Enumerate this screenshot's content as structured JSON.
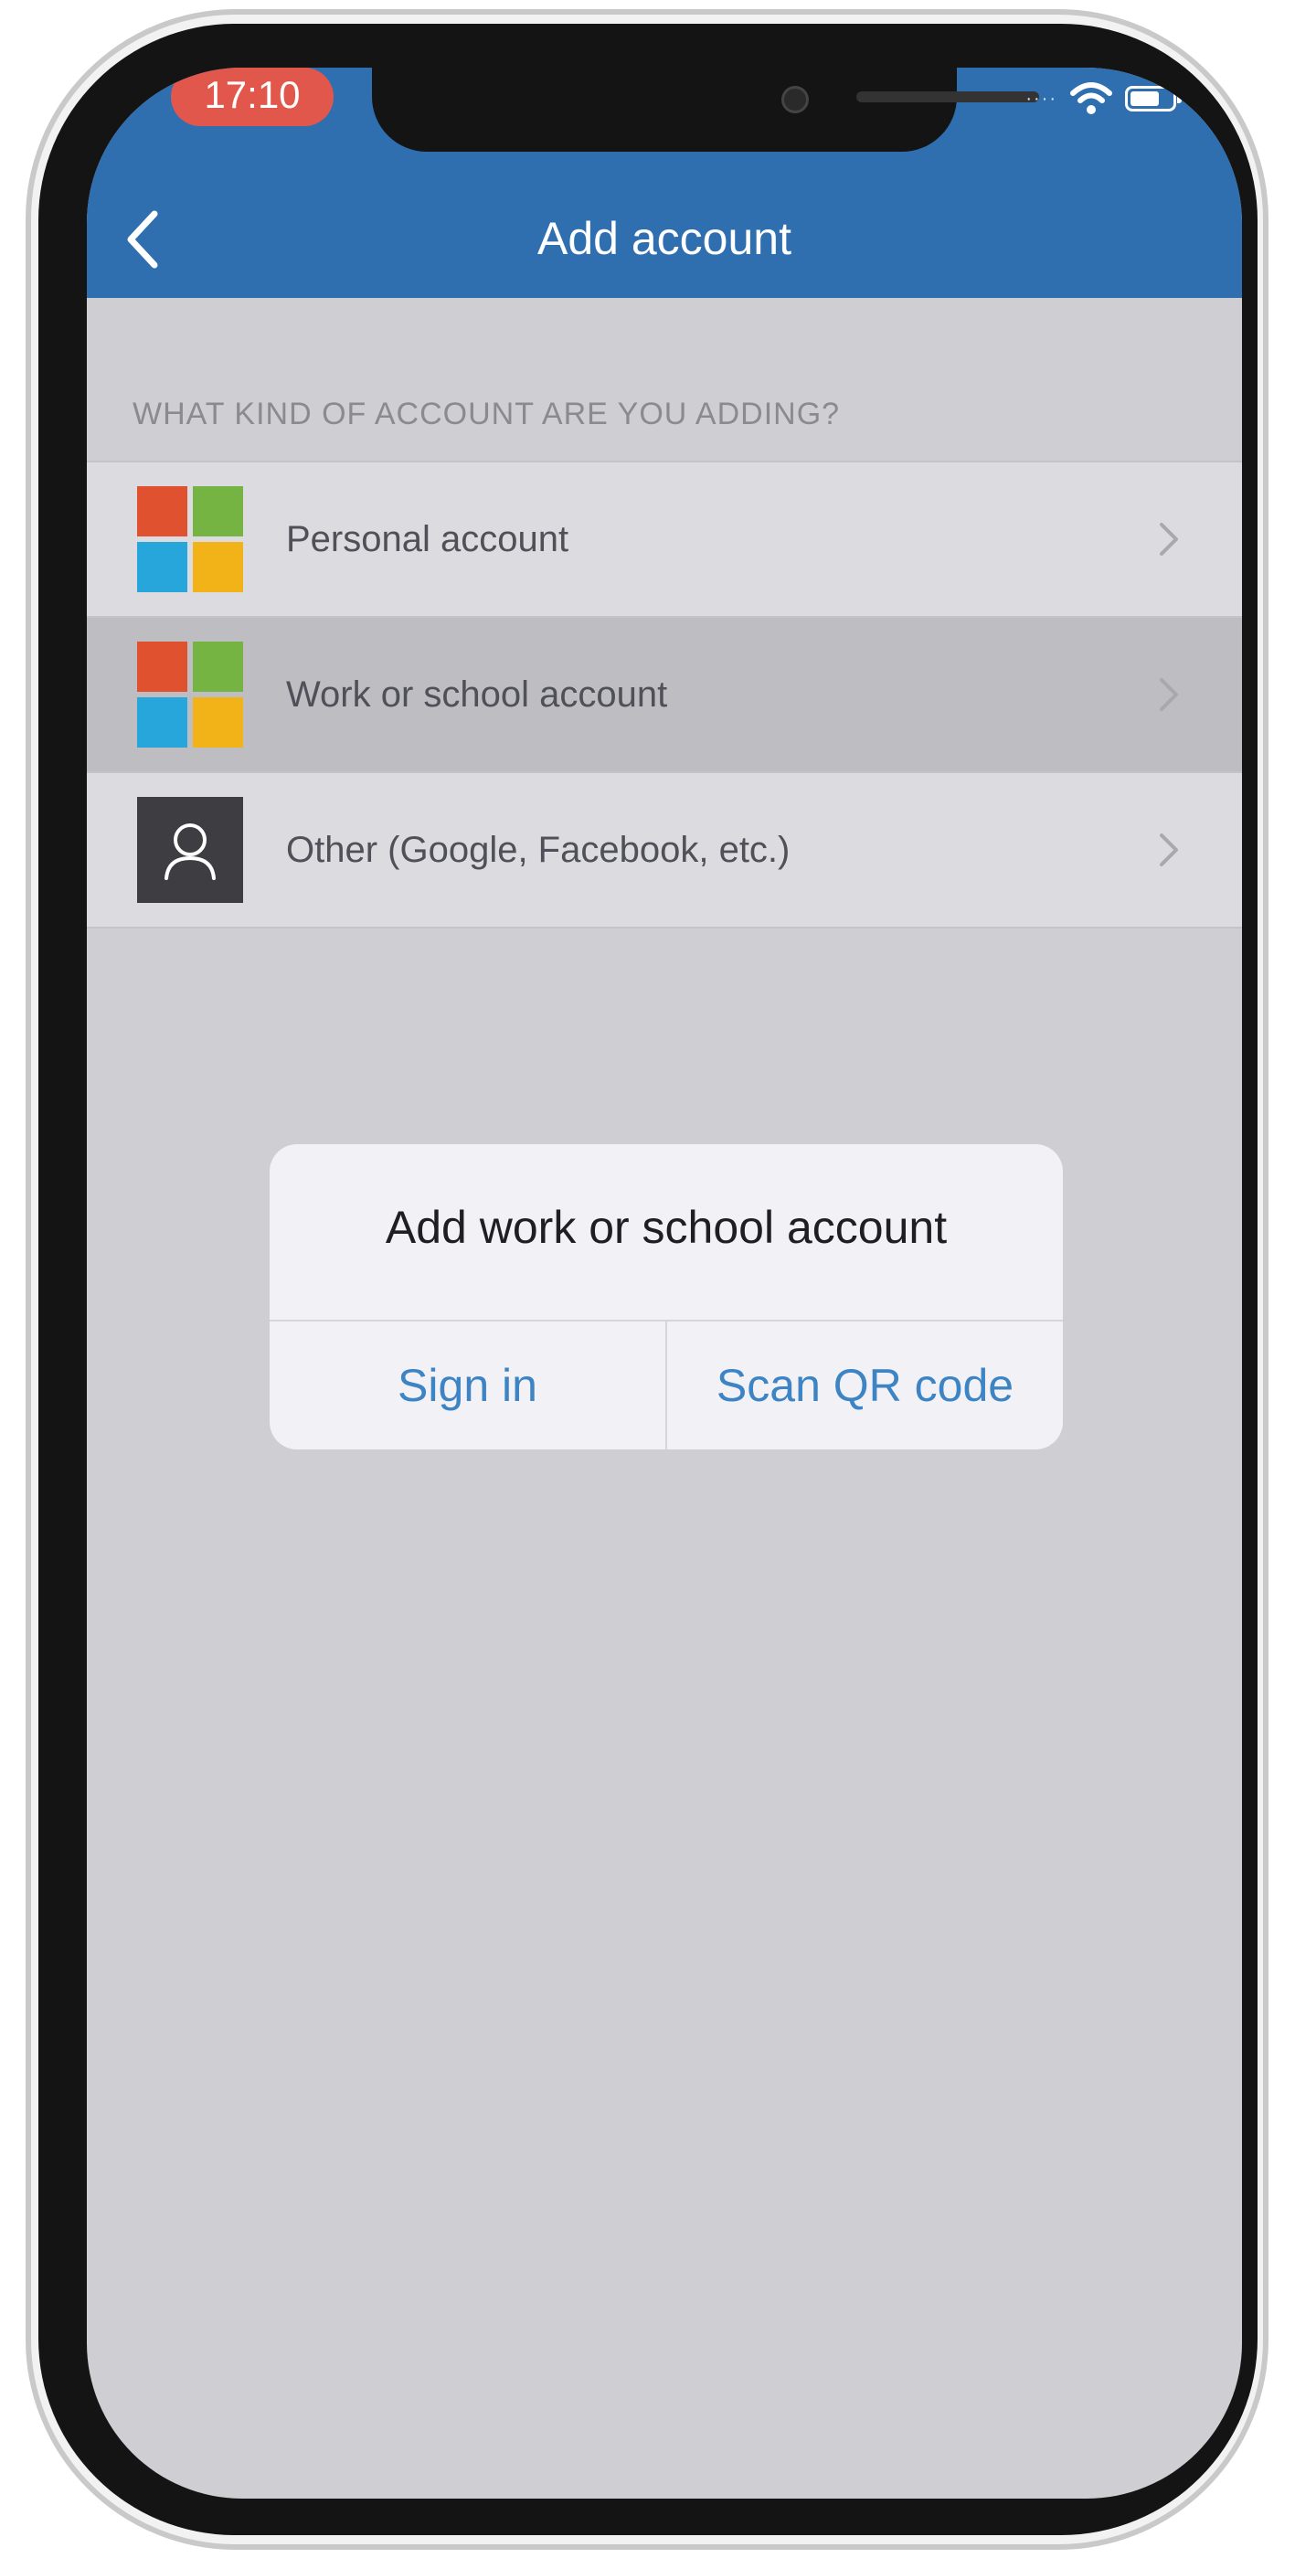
{
  "status_bar": {
    "time": "17:10",
    "signal_dots": "····"
  },
  "header": {
    "title": "Add account"
  },
  "section_label": "WHAT KIND OF ACCOUNT ARE YOU ADDING?",
  "accounts": [
    {
      "label": "Personal account",
      "icon": "microsoft-logo-icon"
    },
    {
      "label": "Work or school account",
      "icon": "microsoft-logo-icon",
      "selected": true
    },
    {
      "label": "Other (Google, Facebook, etc.)",
      "icon": "person-icon"
    }
  ],
  "dialog": {
    "title": "Add work or school account",
    "sign_in": "Sign in",
    "scan_qr": "Scan QR code"
  },
  "colors": {
    "header_blue": "#2f6fb0",
    "time_pill": "#e2574c",
    "link_blue": "#3d84c4",
    "ms_red": "#e0512f",
    "ms_green": "#75b443",
    "ms_blue": "#27a6dc",
    "ms_yellow": "#f2b318"
  }
}
